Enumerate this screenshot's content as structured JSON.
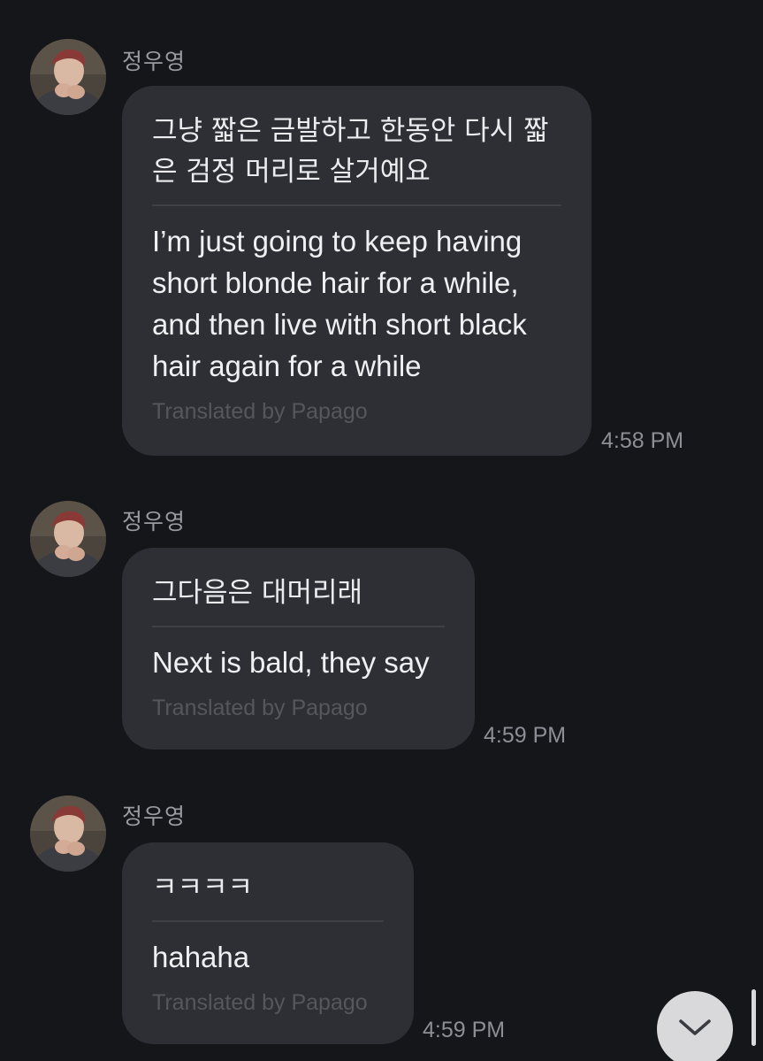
{
  "messages": [
    {
      "sender": "정우영",
      "original": "그냥 짧은 금발하고 한동안 다시 짧은 검정 머리로 살거예요",
      "translated": "I’m just going to keep having short blonde hair for a while, and then live with short black hair again for a while",
      "credit": "Translated by Papago",
      "time": "4:58 PM"
    },
    {
      "sender": "정우영",
      "original": "그다음은 대머리래",
      "translated": "Next is bald, they say",
      "credit": "Translated by Papago",
      "time": "4:59 PM"
    },
    {
      "sender": "정우영",
      "original": "ㅋㅋㅋㅋ",
      "translated": "hahaha",
      "credit": "Translated by Papago",
      "time": "4:59 PM"
    }
  ],
  "icons": {
    "scroll_down": "chevron-down-icon"
  },
  "colors": {
    "background": "#151619",
    "bubble": "#2e2f34",
    "credit": "#55575e",
    "scroll_button": "#d9d9dc"
  }
}
